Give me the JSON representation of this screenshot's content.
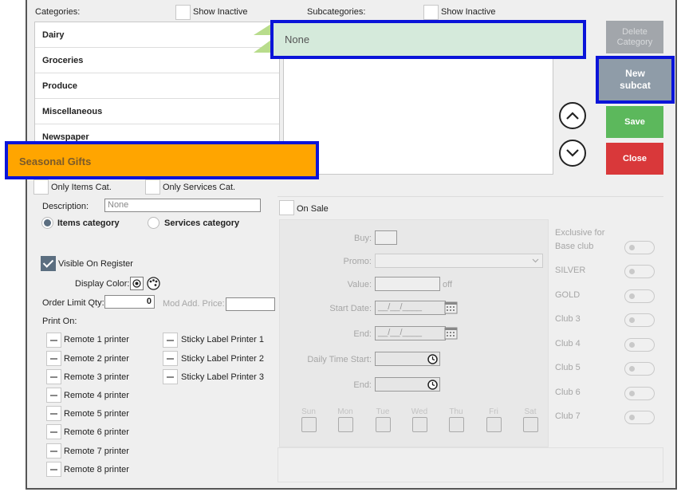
{
  "categories_panel": {
    "title": "Categories:",
    "show_inactive_label": "Show Inactive",
    "items": [
      "Dairy",
      "Groceries",
      "Produce",
      "Miscellaneous",
      "Newspaper"
    ],
    "highlighted_item": "Seasonal Gifts",
    "only_items_label": "Only Items Cat.",
    "only_services_label": "Only Services Cat."
  },
  "subcategories_panel": {
    "title": "Subcategories:",
    "show_inactive_label": "Show Inactive",
    "selected_item": "None"
  },
  "buttons": {
    "delete_category": "Delete\nCategory",
    "new_subcat": "New\nsubcat",
    "save": "Save",
    "close": "Close"
  },
  "details": {
    "description_label": "Description:",
    "description_placeholder": "None",
    "items_category_label": "Items category",
    "services_category_label": "Services category",
    "visible_on_register_label": "Visible On Register",
    "display_color_label": "Display Color:",
    "order_limit_label": "Order Limit Qty:",
    "order_limit_value": "0",
    "mod_add_price_label": "Mod Add. Price:",
    "print_on_label": "Print On:",
    "printers_left": [
      "Remote 1 printer",
      "Remote 2 printer",
      "Remote 3 printer",
      "Remote 4 printer",
      "Remote 5 printer",
      "Remote 6 printer",
      "Remote 7 printer",
      "Remote 8 printer"
    ],
    "printers_right": [
      "Sticky Label Printer 1",
      "Sticky Label Printer 2",
      "Sticky Label Printer 3"
    ]
  },
  "sale": {
    "on_sale_label": "On Sale",
    "buy_label": "Buy:",
    "promo_label": "Promo:",
    "value_label": "Value:",
    "value_suffix": "off",
    "start_date_label": "Start Date:",
    "end_label": "End:",
    "date_placeholder": "__/__/____",
    "daily_time_start_label": "Daily Time Start:",
    "days": [
      "Sun",
      "Mon",
      "Tue",
      "Wed",
      "Thu",
      "Fri",
      "Sat"
    ]
  },
  "clubs": {
    "header_line1": "Exclusive for",
    "header_line2": "Base club",
    "items": [
      "SILVER",
      "GOLD",
      "Club 3",
      "Club 4",
      "Club 5",
      "Club 6",
      "Club 7"
    ]
  },
  "colors": {
    "save": "#5cb85c",
    "close": "#d9383a",
    "new_subcat": "#8f9ca8",
    "delete_disabled": "#a2a6ab",
    "highlight_border": "#0a14d9",
    "seasonal_bg": "#ffa500",
    "none_bg": "#d5eadb"
  }
}
